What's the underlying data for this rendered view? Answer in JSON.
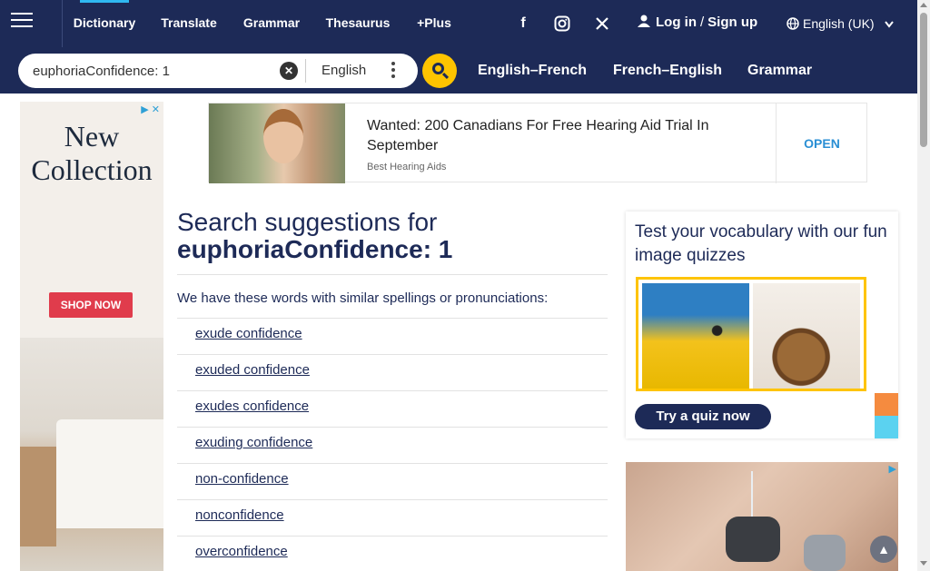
{
  "nav": {
    "items": [
      {
        "label": "Dictionary"
      },
      {
        "label": "Translate"
      },
      {
        "label": "Grammar"
      },
      {
        "label": "Thesaurus"
      },
      {
        "label": "+Plus"
      }
    ],
    "login": "Log in",
    "slash": "/",
    "signup": "Sign up",
    "language": "English (UK)"
  },
  "search": {
    "value": "euphoriaConfidence: 1",
    "dictionary": "English",
    "tabs": [
      "English–French",
      "French–English",
      "Grammar"
    ]
  },
  "left_ad": {
    "title_line1": "New",
    "title_line2": "Collection",
    "button": "SHOP NOW"
  },
  "banner_ad": {
    "headline": "Wanted: 200 Canadians For Free Hearing Aid Trial In September",
    "source": "Best Hearing Aids",
    "cta": "OPEN"
  },
  "main": {
    "heading_prefix": "Search suggestions for",
    "heading_term": "euphoriaConfidence: 1",
    "intro": "We have these words with similar spellings or pronunciations:",
    "suggestions": [
      "exude confidence",
      "exuded confidence",
      "exudes confidence",
      "exuding confidence",
      "non-confidence",
      "nonconfidence",
      "overconfidence"
    ]
  },
  "quiz": {
    "title": "Test your vocabulary with our fun image quizzes",
    "button": "Try a quiz now"
  },
  "colors": {
    "brand_navy": "#1d2a57",
    "accent_yellow": "#fec400",
    "accent_blue": "#2fb8f1"
  }
}
